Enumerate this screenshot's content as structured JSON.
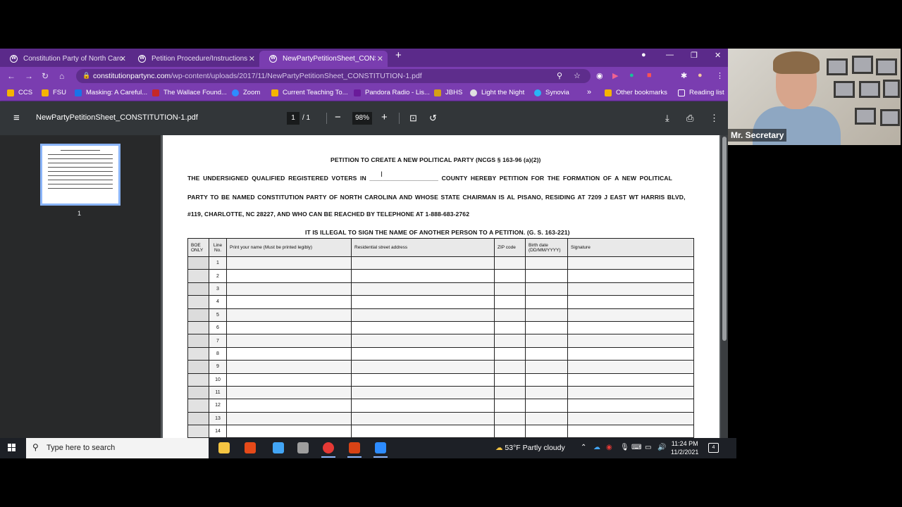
{
  "tabs": [
    {
      "label": "Constitution Party of North Caro",
      "active": false
    },
    {
      "label": "Petition Procedure/Instructions",
      "active": false
    },
    {
      "label": "NewPartyPetitionSheet_CONSTIT",
      "active": true
    }
  ],
  "address_bar": {
    "host": "constitutionpartync.com",
    "path": "/wp-content/uploads/2017/11/NewPartyPetitionSheet_CONSTITUTION-1.pdf"
  },
  "bookmarks": [
    {
      "label": "CCS",
      "color": "#f5b400"
    },
    {
      "label": "FSU",
      "color": "#f5b400"
    },
    {
      "label": "Masking: A Careful...",
      "color": "#1a73e8"
    },
    {
      "label": "The Wallace Found...",
      "color": "#c62828"
    },
    {
      "label": "Zoom",
      "color": "#2d8cff"
    },
    {
      "label": "Current Teaching To...",
      "color": "#f5b400"
    },
    {
      "label": "Pandora Radio - Lis...",
      "color": "#6a1b9a"
    },
    {
      "label": "JBHS",
      "color": "#d4a017"
    },
    {
      "label": "Light the Night",
      "color": "#e0e0e0"
    },
    {
      "label": "Synovia",
      "color": "#29b6f6"
    }
  ],
  "bookmarks_right": {
    "overflow": "»",
    "other": "Other bookmarks",
    "reading": "Reading list"
  },
  "pdf": {
    "filename": "NewPartyPetitionSheet_CONSTITUTION-1.pdf",
    "page_current": "1",
    "page_total": "/  1",
    "zoom": "98%",
    "thumb_label": "1",
    "title": "PETITION TO CREATE A NEW POLITICAL PARTY (NCGS § 163-96 (a)(2))",
    "line1": "THE UNDERSIGNED QUALIFIED REGISTERED VOTERS IN ____________________ COUNTY HEREBY PETITION FOR THE FORMATION OF A NEW POLITICAL",
    "line2": "PARTY TO BE NAMED CONSTITUTION PARTY OF NORTH CAROLINA AND WHOSE STATE CHAIRMAN IS AL PISANO, RESIDING AT 7209 J EAST WT HARRIS BLVD,",
    "line3": "#119, CHARLOTTE, NC 28227, AND WHO CAN BE REACHED BY TELEPHONE AT 1-888-683-2762",
    "warning": "IT IS ILLEGAL TO SIGN THE NAME OF ANOTHER PERSON TO A PETITION. (G. S. 163-221)",
    "columns": {
      "boe": "BOE ONLY",
      "line": "Line No.",
      "name": "Print your name (Must be printed legibly)",
      "address": "Residential street address",
      "zip": "ZIP code",
      "birth": "Birth date (DD/MM/YYYY)",
      "signature": "Signature"
    },
    "rows": [
      "1",
      "2",
      "3",
      "4",
      "5",
      "6",
      "7",
      "8",
      "9",
      "10",
      "11",
      "12",
      "13",
      "14"
    ]
  },
  "taskbar": {
    "search_placeholder": "Type here to search",
    "weather": "53°F  Partly cloudy",
    "time": "11:24 PM",
    "date": "11/2/2021",
    "notify_count": "4"
  },
  "webcam": {
    "name": "Mr. Secretary"
  }
}
